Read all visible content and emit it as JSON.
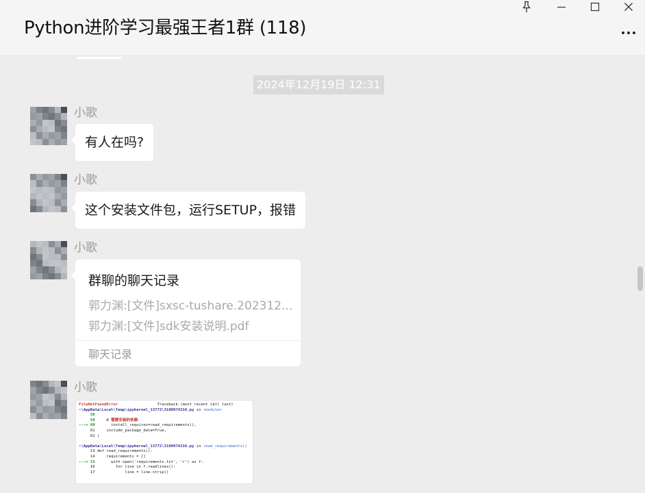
{
  "window": {
    "title": "Python进阶学习最强王者1群 (118)"
  },
  "icons": {
    "pin": "pin-icon",
    "minimize": "minimize-icon",
    "maximize": "maximize-icon",
    "close": "close-icon",
    "more": "more-icon"
  },
  "chat": {
    "timestamp": "2024年12月19日 12:31",
    "messages": [
      {
        "sender": "小歌",
        "text": "有人在吗?"
      },
      {
        "sender": "小歌",
        "text": "这个安装文件包，运行SETUP，报错"
      },
      {
        "sender": "小歌",
        "card": {
          "title": "群聊的聊天记录",
          "lines": [
            "郭力渊:[文件]sxsc-tushare.202312...",
            "郭力渊:[文件]sdk安装说明.pdf"
          ],
          "footer": "聊天记录"
        }
      },
      {
        "sender": "小歌",
        "image": {
          "l01a": "FileNotFoundError",
          "l01b": "Traceback (most recent call last)",
          "l02a": "~\\AppData\\Local\\Temp\\ipykernel_13772\\3100974316.py",
          "l02b": " in ",
          "l02c": "<module>",
          "l03": "     58",
          "l04a": "     59     ",
          "l04b": "# 需要安装的依赖",
          "l05a": "---> 60",
          "l05b": "       install_requires=read_requirements(),",
          "l06": "     61     include_package_data=True,",
          "l07": "     62 )",
          "l08": "",
          "l09a": "~\\AppData\\Local\\Temp\\ipykernel_13772\\3100974316.py",
          "l09b": " in ",
          "l09c": "read_requirements()",
          "l10": "     13 def read_requirements():",
          "l11": "     14     requirements = []",
          "l12a": "---> 15",
          "l12b": "       with open('requirements.txt', 'r') as f:",
          "l13": "     16         for line in f.readlines():",
          "l14": "     17             line = line.strip()"
        }
      }
    ]
  },
  "colors": {
    "background": "#ededed",
    "bubble": "#ffffff",
    "sender_name": "#9a9a9a",
    "timestamp_bg": "#dadada"
  }
}
